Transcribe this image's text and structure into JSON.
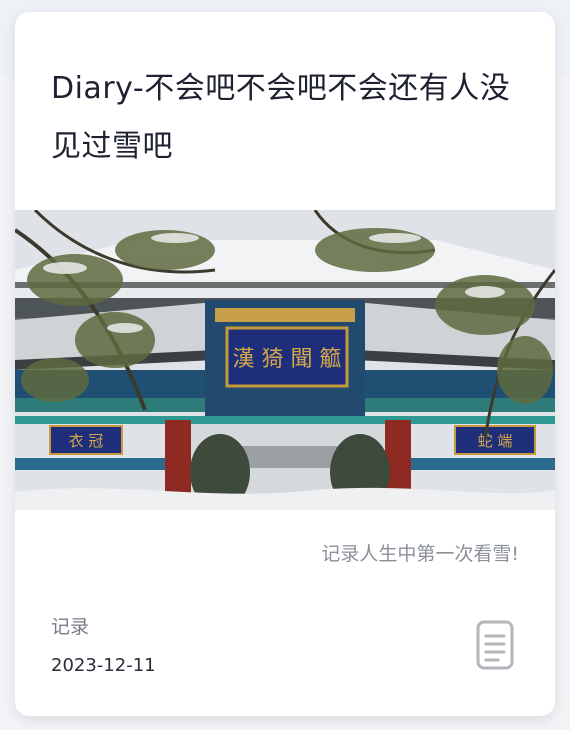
{
  "post": {
    "title": "Diary-不会吧不会吧不会还有人没见过雪吧",
    "summary": "记录人生中第一次看雪!",
    "category": "记录",
    "date": "2023-12-11"
  },
  "image": {
    "subject": "paifang-gate-in-snow",
    "sign_main": "漢 猗 聞 䉉",
    "sign_left": "衣 冠",
    "sign_right": "蛇 端"
  },
  "icons": {
    "post_type": "document-icon"
  },
  "colors": {
    "title": "#1e2230",
    "muted": "#8a8f98",
    "card_bg": "#ffffff",
    "page_bg": "#f2f4f7"
  }
}
